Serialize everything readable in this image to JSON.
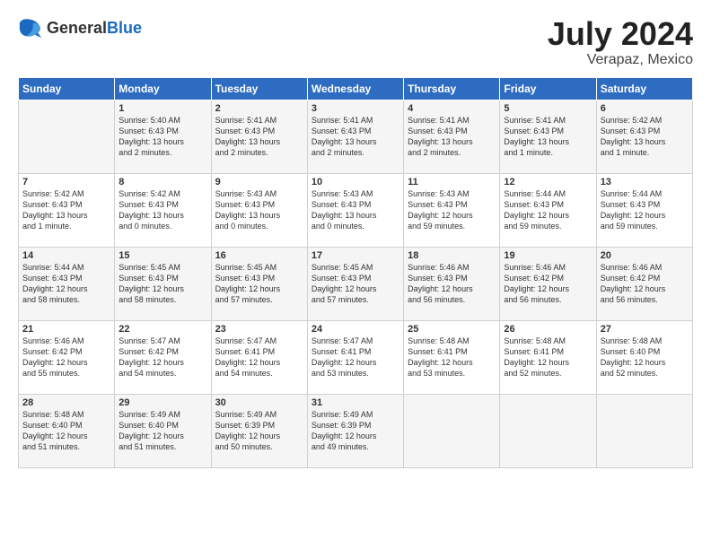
{
  "header": {
    "logo_general": "General",
    "logo_blue": "Blue",
    "title": "July 2024",
    "location": "Verapaz, Mexico"
  },
  "days_of_week": [
    "Sunday",
    "Monday",
    "Tuesday",
    "Wednesday",
    "Thursday",
    "Friday",
    "Saturday"
  ],
  "weeks": [
    [
      {
        "day": "",
        "info": ""
      },
      {
        "day": "1",
        "info": "Sunrise: 5:40 AM\nSunset: 6:43 PM\nDaylight: 13 hours\nand 2 minutes."
      },
      {
        "day": "2",
        "info": "Sunrise: 5:41 AM\nSunset: 6:43 PM\nDaylight: 13 hours\nand 2 minutes."
      },
      {
        "day": "3",
        "info": "Sunrise: 5:41 AM\nSunset: 6:43 PM\nDaylight: 13 hours\nand 2 minutes."
      },
      {
        "day": "4",
        "info": "Sunrise: 5:41 AM\nSunset: 6:43 PM\nDaylight: 13 hours\nand 2 minutes."
      },
      {
        "day": "5",
        "info": "Sunrise: 5:41 AM\nSunset: 6:43 PM\nDaylight: 13 hours\nand 1 minute."
      },
      {
        "day": "6",
        "info": "Sunrise: 5:42 AM\nSunset: 6:43 PM\nDaylight: 13 hours\nand 1 minute."
      }
    ],
    [
      {
        "day": "7",
        "info": "Sunrise: 5:42 AM\nSunset: 6:43 PM\nDaylight: 13 hours\nand 1 minute."
      },
      {
        "day": "8",
        "info": "Sunrise: 5:42 AM\nSunset: 6:43 PM\nDaylight: 13 hours\nand 0 minutes."
      },
      {
        "day": "9",
        "info": "Sunrise: 5:43 AM\nSunset: 6:43 PM\nDaylight: 13 hours\nand 0 minutes."
      },
      {
        "day": "10",
        "info": "Sunrise: 5:43 AM\nSunset: 6:43 PM\nDaylight: 13 hours\nand 0 minutes."
      },
      {
        "day": "11",
        "info": "Sunrise: 5:43 AM\nSunset: 6:43 PM\nDaylight: 12 hours\nand 59 minutes."
      },
      {
        "day": "12",
        "info": "Sunrise: 5:44 AM\nSunset: 6:43 PM\nDaylight: 12 hours\nand 59 minutes."
      },
      {
        "day": "13",
        "info": "Sunrise: 5:44 AM\nSunset: 6:43 PM\nDaylight: 12 hours\nand 59 minutes."
      }
    ],
    [
      {
        "day": "14",
        "info": "Sunrise: 5:44 AM\nSunset: 6:43 PM\nDaylight: 12 hours\nand 58 minutes."
      },
      {
        "day": "15",
        "info": "Sunrise: 5:45 AM\nSunset: 6:43 PM\nDaylight: 12 hours\nand 58 minutes."
      },
      {
        "day": "16",
        "info": "Sunrise: 5:45 AM\nSunset: 6:43 PM\nDaylight: 12 hours\nand 57 minutes."
      },
      {
        "day": "17",
        "info": "Sunrise: 5:45 AM\nSunset: 6:43 PM\nDaylight: 12 hours\nand 57 minutes."
      },
      {
        "day": "18",
        "info": "Sunrise: 5:46 AM\nSunset: 6:43 PM\nDaylight: 12 hours\nand 56 minutes."
      },
      {
        "day": "19",
        "info": "Sunrise: 5:46 AM\nSunset: 6:42 PM\nDaylight: 12 hours\nand 56 minutes."
      },
      {
        "day": "20",
        "info": "Sunrise: 5:46 AM\nSunset: 6:42 PM\nDaylight: 12 hours\nand 56 minutes."
      }
    ],
    [
      {
        "day": "21",
        "info": "Sunrise: 5:46 AM\nSunset: 6:42 PM\nDaylight: 12 hours\nand 55 minutes."
      },
      {
        "day": "22",
        "info": "Sunrise: 5:47 AM\nSunset: 6:42 PM\nDaylight: 12 hours\nand 54 minutes."
      },
      {
        "day": "23",
        "info": "Sunrise: 5:47 AM\nSunset: 6:41 PM\nDaylight: 12 hours\nand 54 minutes."
      },
      {
        "day": "24",
        "info": "Sunrise: 5:47 AM\nSunset: 6:41 PM\nDaylight: 12 hours\nand 53 minutes."
      },
      {
        "day": "25",
        "info": "Sunrise: 5:48 AM\nSunset: 6:41 PM\nDaylight: 12 hours\nand 53 minutes."
      },
      {
        "day": "26",
        "info": "Sunrise: 5:48 AM\nSunset: 6:41 PM\nDaylight: 12 hours\nand 52 minutes."
      },
      {
        "day": "27",
        "info": "Sunrise: 5:48 AM\nSunset: 6:40 PM\nDaylight: 12 hours\nand 52 minutes."
      }
    ],
    [
      {
        "day": "28",
        "info": "Sunrise: 5:48 AM\nSunset: 6:40 PM\nDaylight: 12 hours\nand 51 minutes."
      },
      {
        "day": "29",
        "info": "Sunrise: 5:49 AM\nSunset: 6:40 PM\nDaylight: 12 hours\nand 51 minutes."
      },
      {
        "day": "30",
        "info": "Sunrise: 5:49 AM\nSunset: 6:39 PM\nDaylight: 12 hours\nand 50 minutes."
      },
      {
        "day": "31",
        "info": "Sunrise: 5:49 AM\nSunset: 6:39 PM\nDaylight: 12 hours\nand 49 minutes."
      },
      {
        "day": "",
        "info": ""
      },
      {
        "day": "",
        "info": ""
      },
      {
        "day": "",
        "info": ""
      }
    ]
  ]
}
